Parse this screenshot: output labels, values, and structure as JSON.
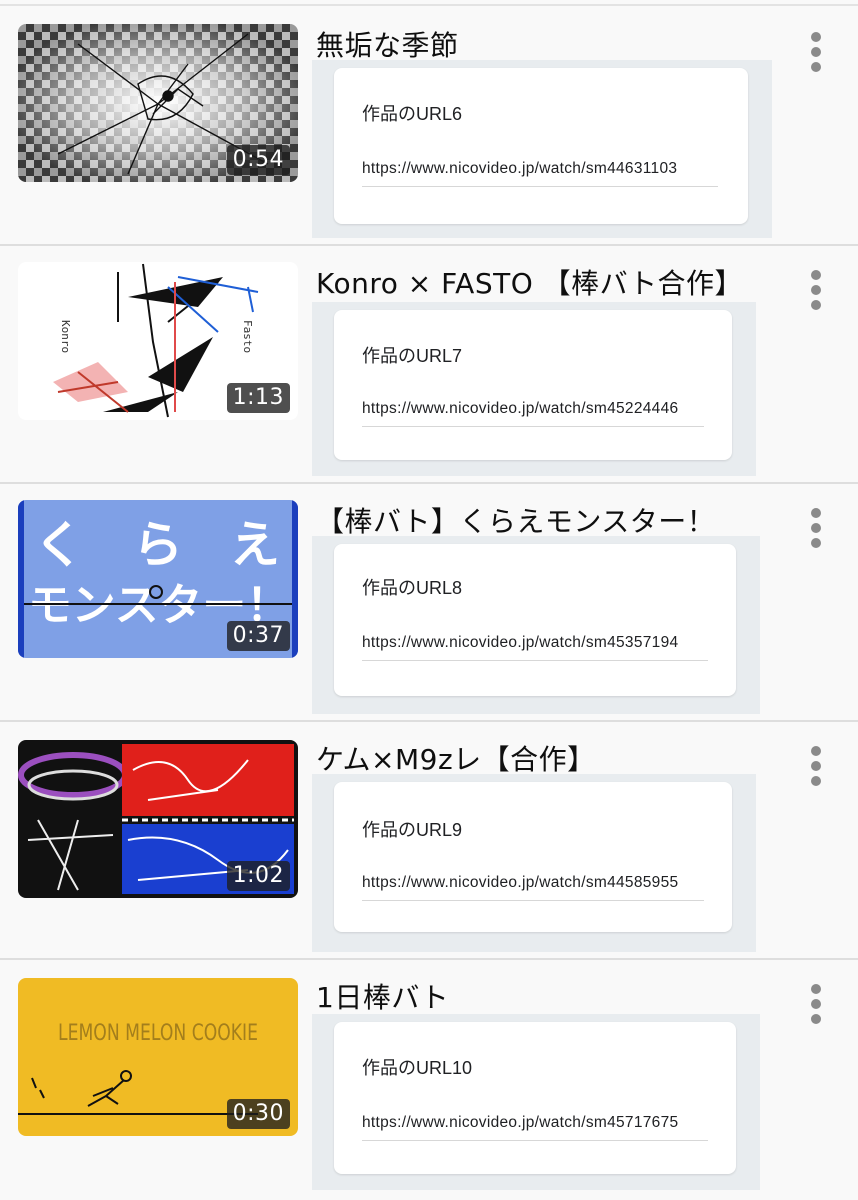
{
  "videos": [
    {
      "title": "無垢な季節",
      "duration": "0:54",
      "label": "作品のURL6",
      "url": "https://www.nicovideo.jp/watch/sm44631103",
      "thumb_colors": [
        "#111111",
        "#dddddd"
      ]
    },
    {
      "title": "Konro × FASTO 【棒バト合作】",
      "duration": "1:13",
      "label": "作品のURL7",
      "url": "https://www.nicovideo.jp/watch/sm45224446",
      "thumb_colors": [
        "#ffffff",
        "#c0392b",
        "#1f5fd6"
      ],
      "thumb_text": [
        "Konro",
        "Fasto"
      ]
    },
    {
      "title": "【棒バト】くらえモンスター！",
      "duration": "0:37",
      "label": "作品のURL8",
      "url": "https://www.nicovideo.jp/watch/sm45357194",
      "thumb_colors": [
        "#7fa0e6",
        "#1b3fbd",
        "#ffffff"
      ],
      "thumb_text": [
        "く",
        "ら",
        "え",
        "モンスター！"
      ]
    },
    {
      "title": "ケム×M9zレ【合作】",
      "duration": "1:02",
      "label": "作品のURL9",
      "url": "https://www.nicovideo.jp/watch/sm44585955",
      "thumb_colors": [
        "#111111",
        "#e0201b",
        "#1a3fd0",
        "#9b4fbf"
      ]
    },
    {
      "title": "1日棒バト",
      "duration": "0:30",
      "label": "作品のURL10",
      "url": "https://www.nicovideo.jp/watch/sm45717675",
      "thumb_colors": [
        "#f0bb24"
      ],
      "thumb_text": [
        "LEMON MELON COOKIE"
      ]
    }
  ]
}
